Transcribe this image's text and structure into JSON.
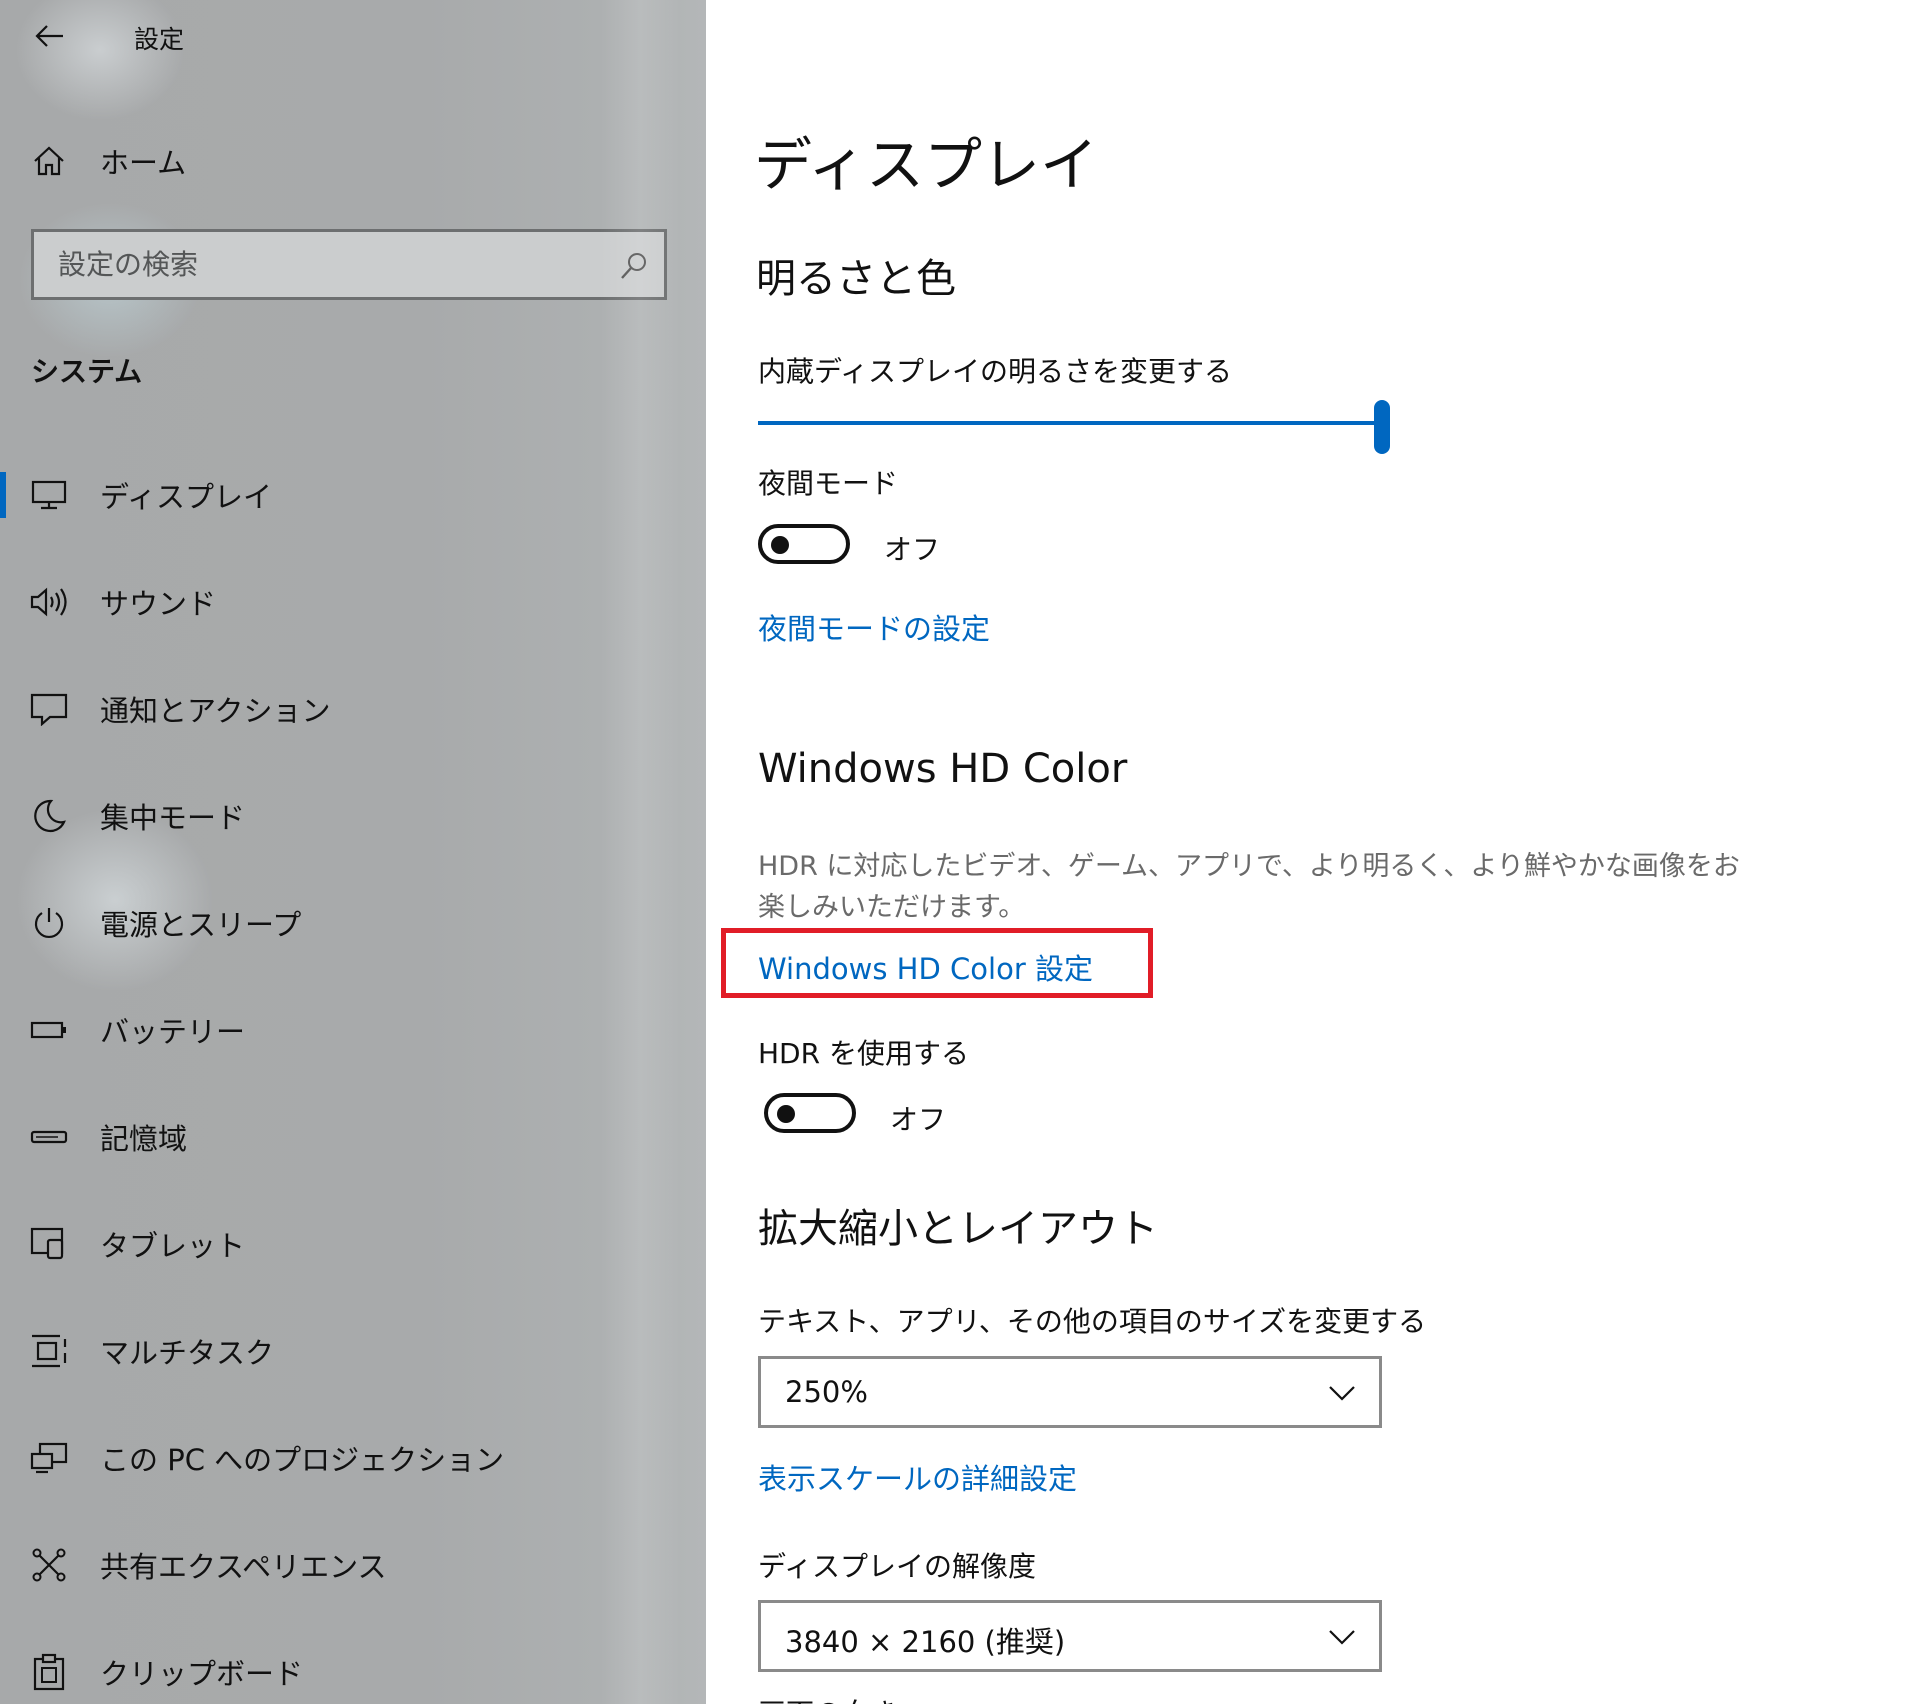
{
  "app": {
    "title": "設定"
  },
  "sidebar": {
    "home_label": "ホーム",
    "search": {
      "placeholder": "設定の検索"
    },
    "section_title": "システム",
    "items": [
      {
        "label": "ディスプレイ",
        "icon": "monitor-icon",
        "selected": true
      },
      {
        "label": "サウンド",
        "icon": "speaker-icon"
      },
      {
        "label": "通知とアクション",
        "icon": "notification-icon"
      },
      {
        "label": "集中モード",
        "icon": "moon-icon"
      },
      {
        "label": "電源とスリープ",
        "icon": "power-icon"
      },
      {
        "label": "バッテリー",
        "icon": "battery-icon"
      },
      {
        "label": "記憶域",
        "icon": "storage-icon"
      },
      {
        "label": "タブレット",
        "icon": "tablet-icon"
      },
      {
        "label": "マルチタスク",
        "icon": "multitask-icon"
      },
      {
        "label": "この PC へのプロジェクション",
        "icon": "projection-icon"
      },
      {
        "label": "共有エクスペリエンス",
        "icon": "shared-experience-icon"
      },
      {
        "label": "クリップボード",
        "icon": "clipboard-icon"
      }
    ]
  },
  "main": {
    "page_title": "ディスプレイ",
    "brightness": {
      "heading": "明るさと色",
      "slider_label": "内蔵ディスプレイの明るさを変更する",
      "slider_value": 1.0,
      "night_light_label": "夜間モード",
      "night_light_state": "オフ",
      "night_light_link": "夜間モードの設定"
    },
    "hdr": {
      "heading": "Windows HD Color",
      "description": "HDR に対応したビデオ、ゲーム、アプリで、より明るく、より鮮やかな画像をお楽しみいただけます。",
      "settings_link": "Windows HD Color 設定",
      "use_hdr_label": "HDR を使用する",
      "use_hdr_state": "オフ"
    },
    "scale_layout": {
      "heading": "拡大縮小とレイアウト",
      "scale_label": "テキスト、アプリ、その他の項目のサイズを変更する",
      "scale_value": "250%",
      "advanced_link": "表示スケールの詳細設定",
      "resolution_label": "ディスプレイの解像度",
      "resolution_value": "3840 × 2160 (推奨)",
      "orientation_label_partial": "画面の向き"
    }
  },
  "colors": {
    "accent": "#0067c0",
    "highlight": "#e11d27"
  }
}
